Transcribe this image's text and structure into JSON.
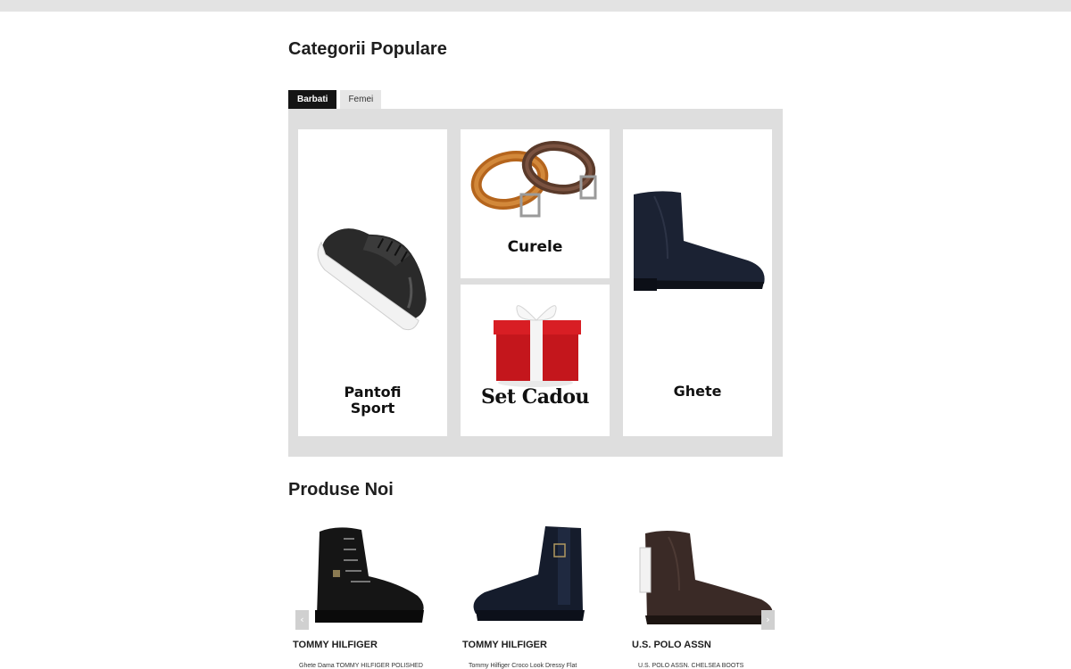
{
  "popular": {
    "title": "Categorii Populare",
    "tabs": [
      {
        "label": "Barbati",
        "active": true
      },
      {
        "label": "Femei",
        "active": false
      }
    ],
    "categories": [
      {
        "label_line1": "Pantofi",
        "label_line2": "Sport",
        "icon": "sneaker-image"
      },
      {
        "label": "Curele",
        "icon": "belts-image"
      },
      {
        "label": "Set Cadou",
        "icon": "gift-box-image"
      },
      {
        "label": "Ghete",
        "icon": "chelsea-boot-image"
      }
    ]
  },
  "new_products": {
    "title": "Produse Noi",
    "prev_icon": "‹",
    "next_icon": "›",
    "items": [
      {
        "brand": "TOMMY HILFIGER",
        "name": "Ghete Dama TOMMY HILFIGER  POLISHED",
        "icon": "lace-up-boot-image"
      },
      {
        "brand": "TOMMY HILFIGER",
        "name": "Tommy Hilfiger Croco Look Dressy Flat",
        "icon": "ankle-boot-image"
      },
      {
        "brand": "U.S. POLO ASSN",
        "name": "U.S. POLO ASSN. CHELSEA BOOTS",
        "icon": "chelsea-boot-image"
      }
    ]
  },
  "colors": {
    "accent": "#151515",
    "panel_bg": "#dedede",
    "topbar": "#e3e3e3"
  }
}
